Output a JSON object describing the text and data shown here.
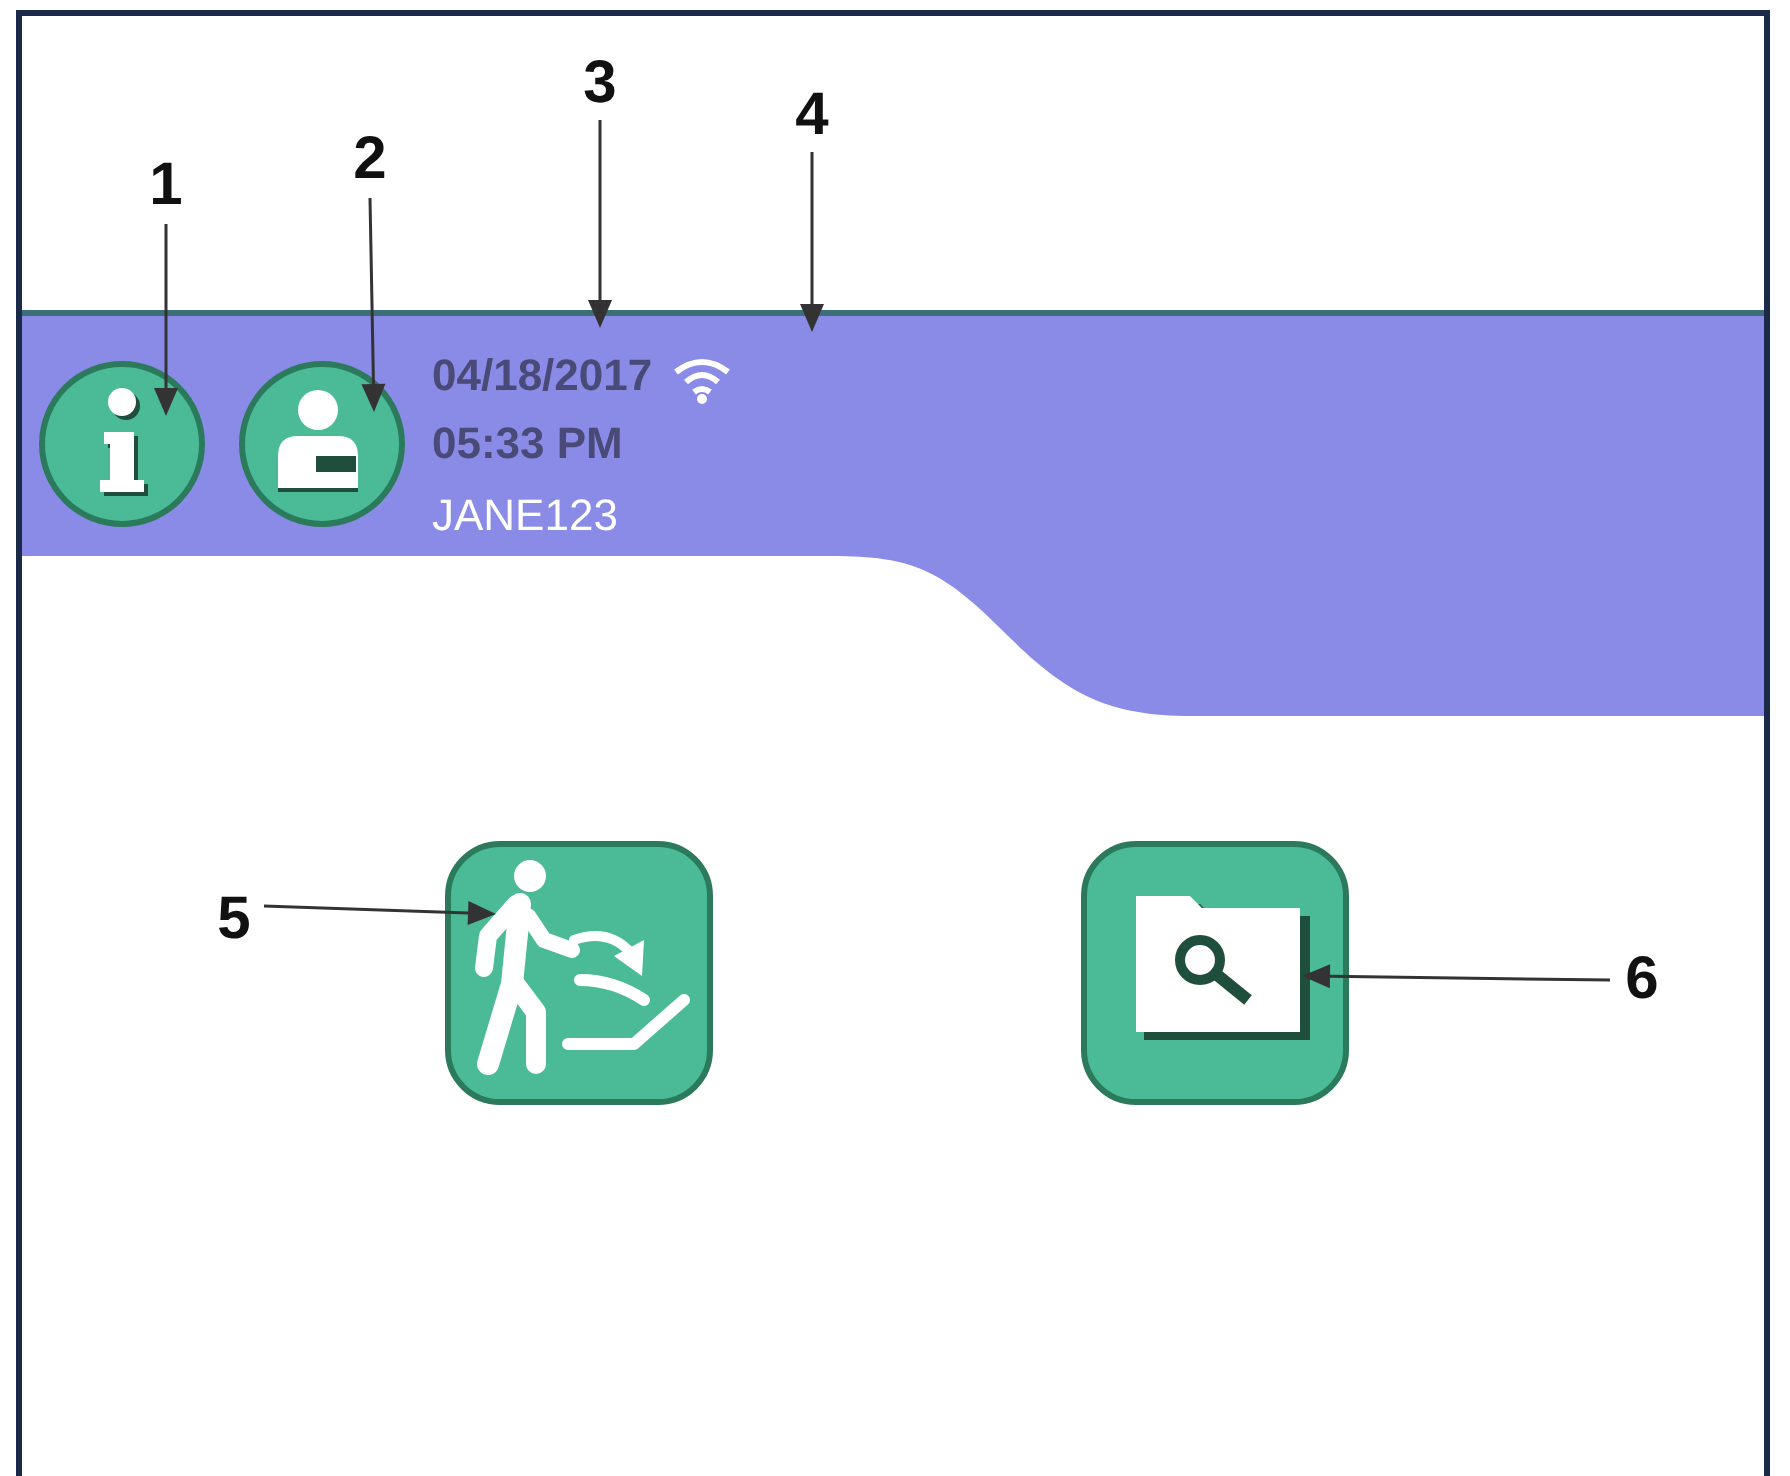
{
  "status": {
    "date": "04/18/2017",
    "time": "05:33 PM",
    "user": "JANE123"
  },
  "callouts": [
    {
      "label": "1"
    },
    {
      "label": "2"
    },
    {
      "label": "3"
    },
    {
      "label": "4"
    },
    {
      "label": "5"
    },
    {
      "label": "6"
    }
  ]
}
